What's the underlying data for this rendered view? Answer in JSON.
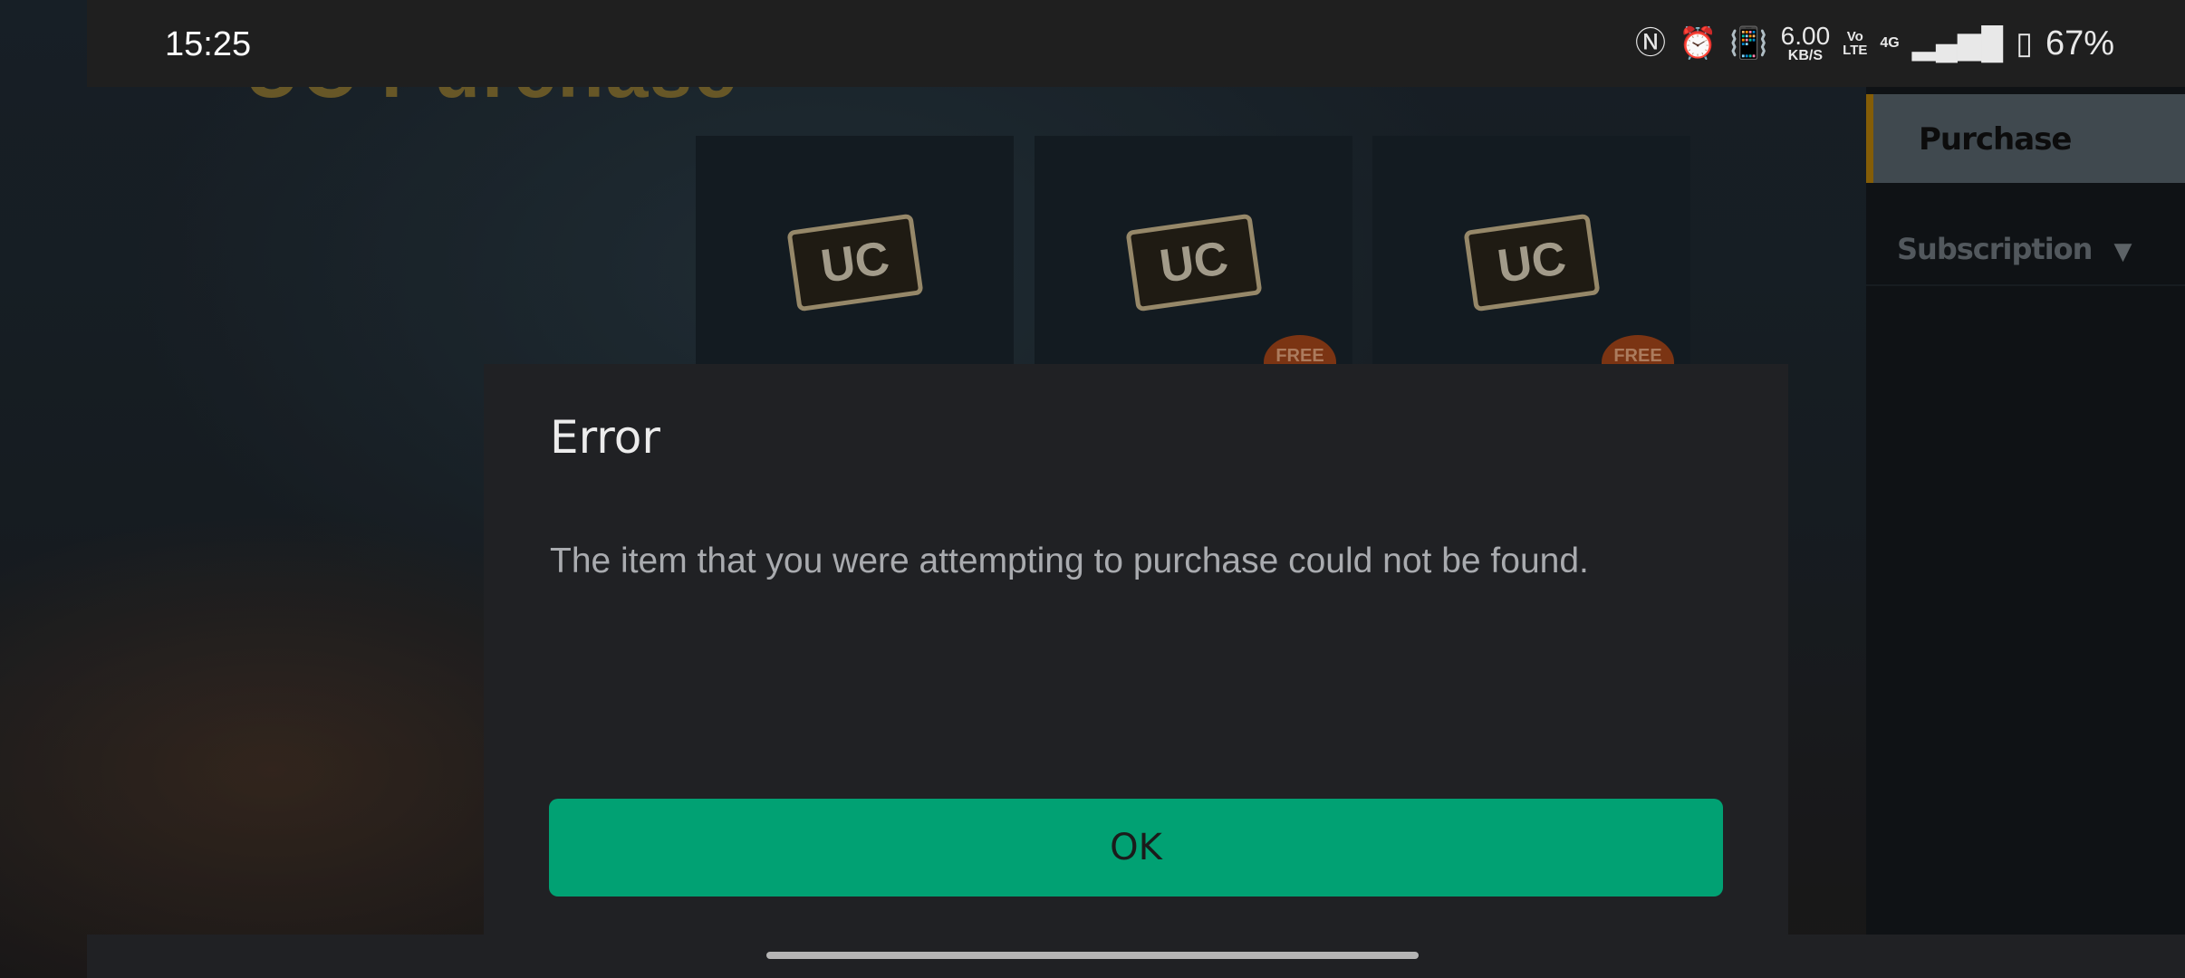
{
  "status_bar": {
    "time": "15:25",
    "icons": [
      "nfc-icon",
      "alarm-icon",
      "vibrate-icon",
      "volte-icon",
      "signal-4g-icon",
      "battery-icon"
    ],
    "net_speed": "6.00",
    "net_speed_unit": "KB/S",
    "volte_top": "Vo",
    "volte_bottom": "LTE",
    "network": "4G",
    "battery": "67%"
  },
  "game": {
    "title": "UC Purchase",
    "cards": [
      {
        "label": "UC",
        "badge": ""
      },
      {
        "label": "UC",
        "badge": "FREE"
      },
      {
        "label": "UC",
        "badge": "FREE"
      }
    ],
    "sidebar": {
      "purchase": "Purchase",
      "subscription": "Subscription",
      "accent": "#b07d0a"
    }
  },
  "dialog": {
    "title": "Error",
    "message": "The item that you were attempting to purchase could not be found.",
    "ok_label": "OK",
    "ok_color": "#01a173"
  }
}
